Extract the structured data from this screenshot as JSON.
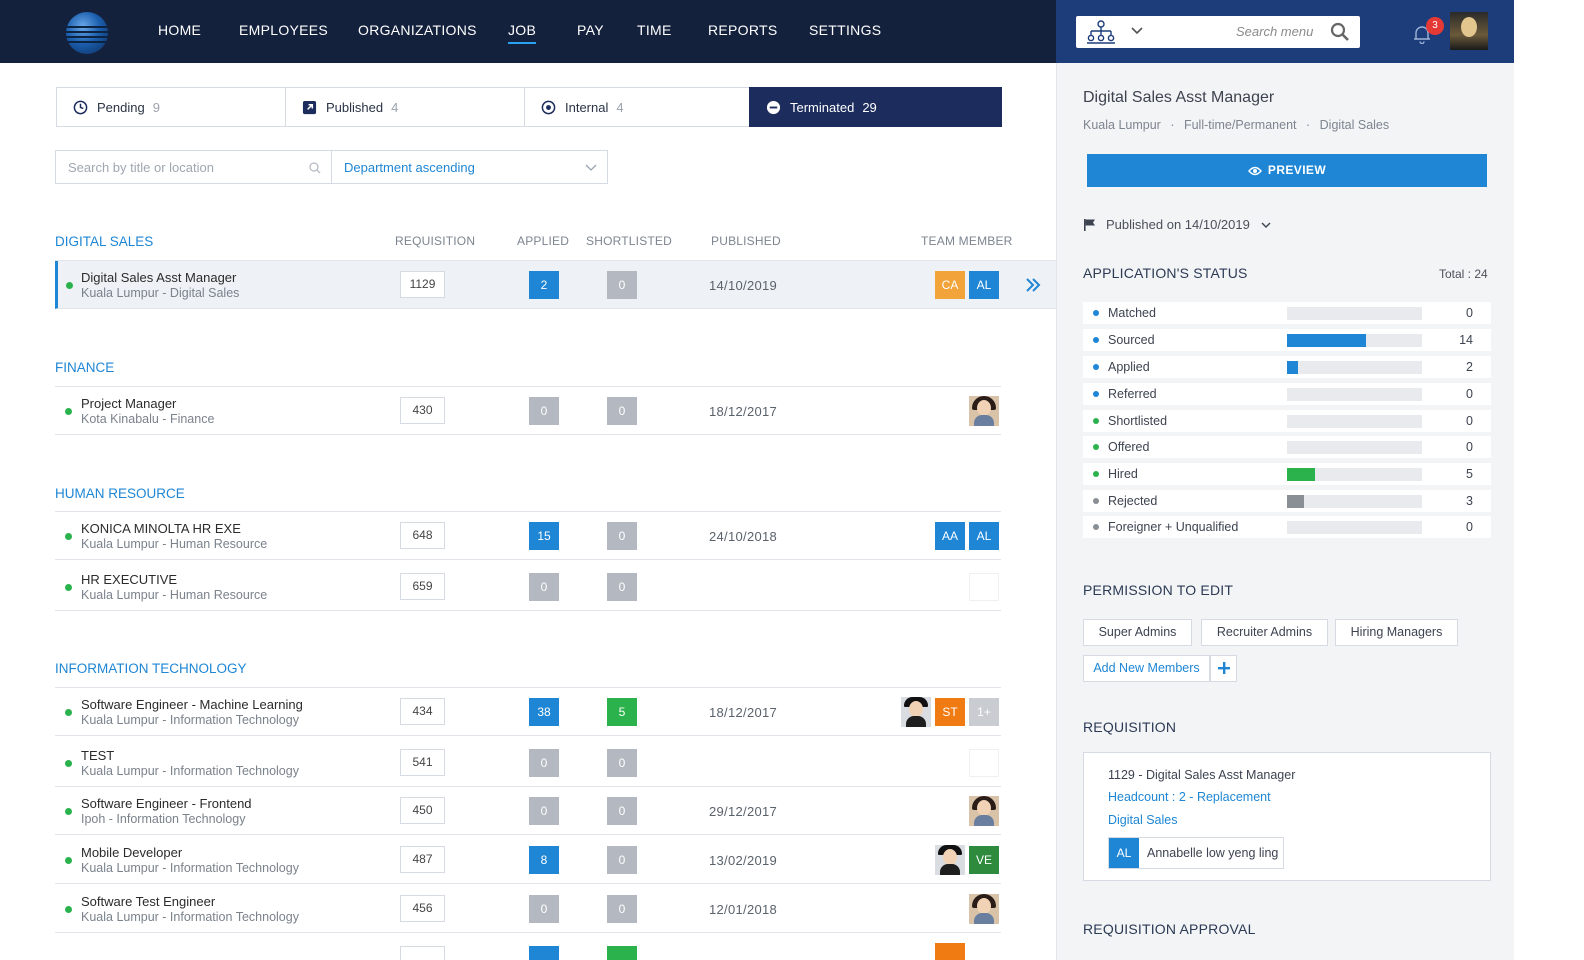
{
  "nav": {
    "items": [
      "HOME",
      "EMPLOYEES",
      "ORGANIZATIONS",
      "JOB",
      "PAY",
      "TIME",
      "REPORTS",
      "SETTINGS"
    ],
    "active": "JOB",
    "search_placeholder": "Search menu",
    "notification_count": "3"
  },
  "tabs": [
    {
      "label": "Pending",
      "count": "9",
      "icon": "clock-icon"
    },
    {
      "label": "Published",
      "count": "4",
      "icon": "external-link-icon"
    },
    {
      "label": "Internal",
      "count": "4",
      "icon": "target-icon"
    },
    {
      "label": "Terminated",
      "count": "29",
      "icon": "minus-circle-icon",
      "active": true
    }
  ],
  "filters": {
    "search_placeholder": "Search by title or location",
    "sort_value": "Department ascending"
  },
  "columns": {
    "requisition": "REQUISITION",
    "applied": "APPLIED",
    "shortlisted": "SHORTLISTED",
    "published": "PUBLISHED",
    "team_member": "TEAM MEMBER"
  },
  "departments": [
    {
      "name": "DIGITAL SALES",
      "jobs": [
        {
          "title": "Digital Sales Asst Manager",
          "subtitle": "Kuala Lumpur - Digital Sales",
          "req": "1129",
          "applied": "2",
          "shortlisted": "0",
          "published": "14/10/2019",
          "members": [
            "CA",
            "AL"
          ]
        }
      ]
    },
    {
      "name": "FINANCE",
      "jobs": [
        {
          "title": "Project Manager",
          "subtitle": "Kota Kinabalu - Finance",
          "req": "430",
          "applied": "0",
          "shortlisted": "0",
          "published": "18/12/2017"
        }
      ]
    },
    {
      "name": "HUMAN RESOURCE",
      "jobs": [
        {
          "title": "KONICA MINOLTA HR EXE",
          "subtitle": "Kuala Lumpur - Human Resource",
          "req": "648",
          "applied": "15",
          "shortlisted": "0",
          "published": "24/10/2018",
          "members": [
            "AA",
            "AL"
          ]
        },
        {
          "title": "HR EXECUTIVE",
          "subtitle": "Kuala Lumpur - Human Resource",
          "req": "659",
          "applied": "0",
          "shortlisted": "0",
          "published": ""
        }
      ]
    },
    {
      "name": "INFORMATION TECHNOLOGY",
      "jobs": [
        {
          "title": "Software Engineer - Machine Learning",
          "subtitle": "Kuala Lumpur - Information Technology",
          "req": "434",
          "applied": "38",
          "shortlisted": "5",
          "published": "18/12/2017",
          "members": [
            "ST",
            "1+"
          ]
        },
        {
          "title": "TEST",
          "subtitle": "Kuala Lumpur - Information Technology",
          "req": "541",
          "applied": "0",
          "shortlisted": "0",
          "published": ""
        },
        {
          "title": "Software Engineer - Frontend",
          "subtitle": "Ipoh - Information Technology",
          "req": "450",
          "applied": "0",
          "shortlisted": "0",
          "published": "29/12/2017"
        },
        {
          "title": "Mobile Developer",
          "subtitle": "Kuala Lumpur - Information Technology",
          "req": "487",
          "applied": "8",
          "shortlisted": "0",
          "published": "13/02/2019",
          "members": [
            "VE"
          ]
        },
        {
          "title": "Software Test Engineer",
          "subtitle": "Kuala Lumpur - Information Technology",
          "req": "456",
          "applied": "0",
          "shortlisted": "0",
          "published": "12/01/2018"
        }
      ]
    }
  ],
  "detail": {
    "title": "Digital Sales Asst Manager",
    "location": "Kuala Lumpur",
    "employment": "Full-time/Permanent",
    "department": "Digital Sales",
    "preview_label": "PREVIEW",
    "published_on": "Published on 14/10/2019",
    "status_heading": "APPLICATION'S STATUS",
    "total": "Total : 24",
    "statuses": [
      {
        "name": "Matched",
        "value": "0",
        "fraction": 0,
        "color": "#1e86d4"
      },
      {
        "name": "Sourced",
        "value": "14",
        "fraction": 0.583,
        "color": "#1e86d4"
      },
      {
        "name": "Applied",
        "value": "2",
        "fraction": 0.083,
        "color": "#1e86d4"
      },
      {
        "name": "Referred",
        "value": "0",
        "fraction": 0,
        "color": "#1e86d4"
      },
      {
        "name": "Shortlisted",
        "value": "0",
        "fraction": 0,
        "color": "#2bb24c"
      },
      {
        "name": "Offered",
        "value": "0",
        "fraction": 0,
        "color": "#2bb24c"
      },
      {
        "name": "Hired",
        "value": "5",
        "fraction": 0.208,
        "color": "#2bb24c"
      },
      {
        "name": "Rejected",
        "value": "3",
        "fraction": 0.125,
        "color": "#8a8f96"
      },
      {
        "name": "Foreigner + Unqualified",
        "value": "0",
        "fraction": 0,
        "color": "#8a8f96"
      }
    ],
    "permission_heading": "PERMISSION TO EDIT",
    "permissions": [
      "Super Admins",
      "Recruiter Admins",
      "Hiring Managers"
    ],
    "add_members": "Add New Members",
    "requisition_heading": "REQUISITION",
    "requisition": {
      "line1": "1129 - Digital Sales Asst Manager",
      "line2": "Headcount : 2 - Replacement",
      "line3": "Digital Sales",
      "member_initials": "AL",
      "member_name": "Annabelle low yeng ling"
    },
    "approval_heading": "REQUISITION APPROVAL"
  },
  "colors": {
    "nav_bg": "#14213d",
    "accent": "#1e86d4",
    "green": "#2bb24c",
    "gray_badge": "#b4b9c1",
    "member_ca": "#f2a33a",
    "member_st": "#ef7b12",
    "member_ve": "#2e8b3e"
  }
}
